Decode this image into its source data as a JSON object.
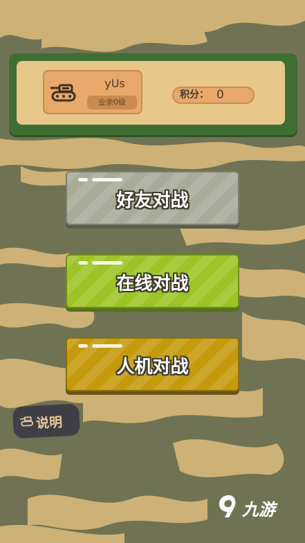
{
  "profile": {
    "username": "yUs",
    "rank": "业余0级",
    "score_label": "积分：",
    "score_value": "0"
  },
  "menu": {
    "friend_battle": "好友对战",
    "online_battle": "在线对战",
    "ai_battle": "人机对战"
  },
  "help": {
    "label": "说明"
  },
  "watermark": {
    "text": "九游"
  },
  "colors": {
    "background": "#6f7353",
    "camo_tan": "#cdb176",
    "panel_green": "#3f6e33",
    "panel_cream": "#e7c78a",
    "friend_button": "#a8ab98",
    "online_button": "#9cc426",
    "ai_button": "#c59a0d"
  },
  "icons": {
    "avatar": "tank-icon",
    "help": "tank-icon",
    "watermark": "jiuyou-logo-icon"
  }
}
